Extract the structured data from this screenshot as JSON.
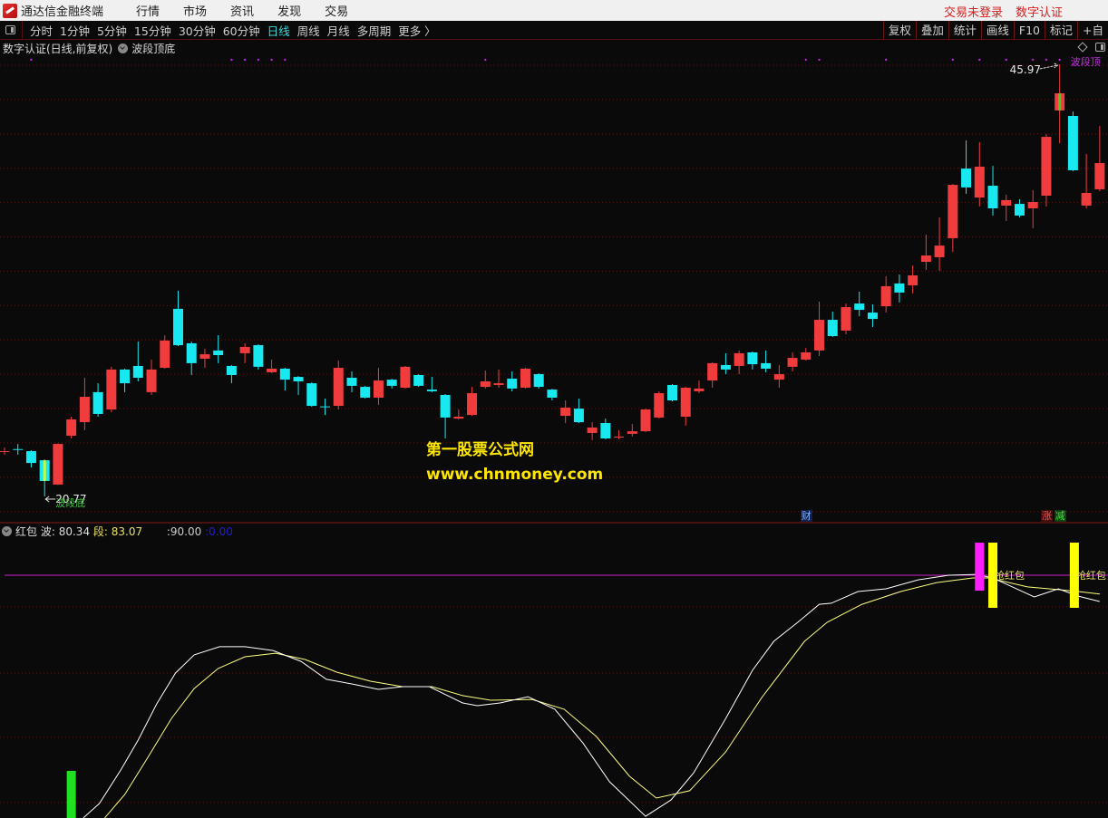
{
  "titlebar": {
    "app_name": "通达信金融终端",
    "menus": [
      "行情",
      "市场",
      "资讯",
      "发现",
      "交易"
    ],
    "right": [
      "交易未登录",
      "数字认证"
    ]
  },
  "toolbar": {
    "periods": [
      "分时",
      "1分钟",
      "5分钟",
      "15分钟",
      "30分钟",
      "60分钟",
      "日线",
      "周线",
      "月线",
      "多周期",
      "更多 〉"
    ],
    "active_period": "日线",
    "right_buttons": [
      "复权",
      "叠加",
      "统计",
      "画线",
      "F10",
      "标记",
      "+自"
    ]
  },
  "info": {
    "stock": "数字认证(日线,前复权)",
    "indicator": "波段顶底"
  },
  "annotations": {
    "high_label": "45.97",
    "low_label": "20.77",
    "top_signal": "波段顶",
    "bottom_signal": "波段底",
    "event_cai": "财",
    "event_zhang": "涨",
    "event_jian": "减"
  },
  "watermark": {
    "line1": "第一股票公式网",
    "line2": "www.chnmoney.com"
  },
  "indicator": {
    "name": "红包",
    "wave_label": "波:",
    "wave_value": "80.34",
    "seg_label": "段:",
    "seg_value": "83.07",
    "level_label": ":90.00",
    "zero_label": ":0.00",
    "signal_text": "抢红包"
  },
  "colors": {
    "up": "#f03c3c",
    "down": "#18e8f0",
    "wave": "#ffffff",
    "seg": "#ffff80",
    "level": "#d020d0",
    "grid": "#5c1818",
    "magenta": "#ff20ff",
    "yellow": "#ffff00",
    "green": "#20e020"
  },
  "chart_data": {
    "type": "candlestick",
    "price_range": [
      20.77,
      45.97
    ],
    "candles": [
      [
        23.38,
        23.62,
        23.2,
        23.41
      ],
      [
        23.53,
        23.83,
        23.2,
        23.5
      ],
      [
        23.41,
        23.46,
        22.46,
        22.72
      ],
      [
        22.88,
        22.93,
        20.77,
        21.67
      ],
      [
        21.46,
        23.86,
        21.43,
        23.83
      ],
      [
        24.31,
        25.42,
        24.15,
        25.26
      ],
      [
        25.1,
        27.69,
        24.63,
        26.58
      ],
      [
        26.85,
        27.37,
        25.42,
        25.58
      ],
      [
        25.84,
        28.33,
        25.68,
        28.17
      ],
      [
        28.17,
        28.22,
        26.85,
        27.37
      ],
      [
        28.38,
        29.8,
        27.48,
        27.69
      ],
      [
        26.85,
        28.75,
        26.69,
        28.17
      ],
      [
        28.27,
        30.17,
        28.22,
        29.86
      ],
      [
        31.71,
        32.76,
        29.54,
        29.59
      ],
      [
        29.7,
        29.8,
        27.85,
        28.54
      ],
      [
        28.8,
        29.38,
        28.27,
        29.06
      ],
      [
        29.28,
        30.17,
        28.54,
        29.01
      ],
      [
        28.38,
        28.43,
        27.37,
        27.85
      ],
      [
        29.12,
        29.7,
        28.54,
        29.49
      ],
      [
        29.59,
        29.64,
        28.17,
        28.33
      ],
      [
        28.01,
        28.75,
        27.96,
        28.22
      ],
      [
        28.22,
        28.27,
        26.95,
        27.58
      ],
      [
        27.74,
        27.79,
        26.69,
        27.48
      ],
      [
        27.37,
        27.42,
        26.0,
        26.05
      ],
      [
        26.02,
        26.48,
        25.52,
        25.98
      ],
      [
        26.05,
        28.7,
        25.84,
        28.27
      ],
      [
        27.69,
        28.06,
        26.85,
        27.22
      ],
      [
        27.16,
        27.21,
        26.48,
        26.53
      ],
      [
        26.53,
        28.27,
        26.11,
        27.53
      ],
      [
        27.58,
        27.63,
        27.06,
        27.22
      ],
      [
        27.11,
        28.38,
        27.06,
        28.33
      ],
      [
        27.85,
        27.9,
        27.16,
        27.22
      ],
      [
        27.0,
        27.74,
        26.85,
        26.9
      ],
      [
        26.69,
        26.74,
        24.15,
        25.37
      ],
      [
        25.31,
        25.84,
        25.26,
        25.42
      ],
      [
        25.52,
        27.16,
        25.47,
        26.79
      ],
      [
        27.16,
        28.11,
        27.06,
        27.48
      ],
      [
        27.27,
        28.17,
        27.11,
        27.37
      ],
      [
        27.64,
        28.06,
        26.9,
        27.06
      ],
      [
        27.11,
        28.27,
        27.06,
        28.22
      ],
      [
        27.9,
        27.95,
        27.06,
        27.16
      ],
      [
        27.0,
        27.05,
        26.37,
        26.53
      ],
      [
        25.47,
        26.37,
        25.05,
        25.95
      ],
      [
        25.89,
        26.48,
        25.05,
        25.1
      ],
      [
        24.47,
        25.1,
        24.05,
        24.79
      ],
      [
        25.05,
        25.31,
        24.1,
        24.15
      ],
      [
        24.2,
        24.63,
        24.1,
        24.26
      ],
      [
        24.42,
        24.99,
        24.26,
        24.57
      ],
      [
        24.57,
        25.89,
        24.52,
        25.84
      ],
      [
        25.37,
        26.9,
        25.31,
        26.79
      ],
      [
        27.27,
        27.32,
        26.32,
        26.37
      ],
      [
        25.42,
        27.16,
        24.89,
        27.11
      ],
      [
        26.9,
        27.53,
        26.79,
        27.06
      ],
      [
        27.53,
        28.59,
        27.11,
        28.54
      ],
      [
        28.43,
        29.12,
        27.9,
        28.17
      ],
      [
        28.38,
        29.28,
        27.9,
        29.12
      ],
      [
        29.17,
        29.22,
        28.17,
        28.48
      ],
      [
        28.54,
        29.28,
        28.01,
        28.22
      ],
      [
        27.58,
        28.43,
        27.11,
        27.9
      ],
      [
        28.33,
        29.17,
        28.06,
        28.85
      ],
      [
        28.75,
        29.43,
        28.7,
        29.17
      ],
      [
        29.28,
        32.13,
        28.96,
        31.07
      ],
      [
        31.07,
        31.55,
        30.07,
        30.12
      ],
      [
        30.44,
        32.02,
        30.23,
        31.81
      ],
      [
        32.02,
        32.71,
        31.28,
        31.65
      ],
      [
        31.49,
        31.97,
        30.65,
        31.12
      ],
      [
        31.86,
        33.61,
        31.49,
        33.03
      ],
      [
        33.19,
        33.71,
        32.08,
        32.66
      ],
      [
        33.08,
        34.24,
        32.6,
        33.66
      ],
      [
        34.45,
        36.04,
        33.98,
        34.82
      ],
      [
        34.72,
        37.04,
        33.93,
        35.4
      ],
      [
        35.83,
        38.99,
        35.03,
        38.94
      ],
      [
        39.89,
        41.53,
        38.42,
        38.79
      ],
      [
        38.2,
        41.43,
        37.68,
        40.0
      ],
      [
        38.89,
        40.05,
        37.15,
        37.57
      ],
      [
        37.73,
        38.36,
        36.83,
        38.05
      ],
      [
        37.83,
        38.1,
        37.04,
        37.15
      ],
      [
        37.57,
        38.63,
        36.41,
        37.94
      ],
      [
        38.31,
        41.9,
        37.68,
        41.74
      ],
      [
        43.28,
        45.97,
        41.37,
        44.28
      ],
      [
        42.96,
        43.22,
        39.74,
        39.79
      ],
      [
        37.73,
        40.74,
        37.57,
        38.47
      ],
      [
        38.68,
        42.38,
        38.57,
        40.21
      ]
    ],
    "highlight_candles": [
      {
        "index": 3,
        "color": "#c8ff40"
      },
      {
        "index": 79,
        "color": "#40d020"
      }
    ],
    "top_dots": [
      2,
      17,
      18,
      19,
      20,
      21,
      36,
      60,
      61,
      66,
      71,
      73,
      75,
      77,
      78,
      79
    ],
    "high_index": 79,
    "low_index": 3,
    "cai_index": 60,
    "zhang_index": 78,
    "jian_index": 79,
    "indicator_range": [
      0,
      90
    ],
    "wave": [
      [
        5.9,
        0.7
      ],
      [
        7.1,
        6
      ],
      [
        8.7,
        18.3
      ],
      [
        10,
        29.3
      ],
      [
        11.4,
        42.7
      ],
      [
        12.8,
        54
      ],
      [
        14.2,
        60.7
      ],
      [
        16.1,
        63.7
      ],
      [
        18,
        63.7
      ],
      [
        20.1,
        62.3
      ],
      [
        22.2,
        58.3
      ],
      [
        24.1,
        51.7
      ],
      [
        26,
        50
      ],
      [
        28,
        48
      ],
      [
        29.8,
        49
      ],
      [
        31.8,
        49
      ],
      [
        34.3,
        43
      ],
      [
        35.4,
        42
      ],
      [
        37.1,
        43
      ],
      [
        39.2,
        45.3
      ],
      [
        41.2,
        40.7
      ],
      [
        43.3,
        28.3
      ],
      [
        45.3,
        14
      ],
      [
        48,
        1.3
      ],
      [
        49.9,
        7.3
      ],
      [
        51.6,
        17.3
      ],
      [
        54,
        37.3
      ],
      [
        56,
        55
      ],
      [
        57.6,
        65.7
      ],
      [
        59.4,
        72.7
      ],
      [
        61,
        79.3
      ],
      [
        61.9,
        79.7
      ],
      [
        63.9,
        84
      ],
      [
        66,
        85
      ],
      [
        68.4,
        88.3
      ],
      [
        70.7,
        90
      ],
      [
        72.8,
        90.3
      ],
      [
        73.7,
        89.3
      ],
      [
        74.3,
        88.3
      ],
      [
        77.1,
        82
      ],
      [
        78.9,
        85
      ],
      [
        80.4,
        82.3
      ],
      [
        82,
        80.34
      ]
    ],
    "segment": [
      [
        7.5,
        0.7
      ],
      [
        9,
        9.3
      ],
      [
        10.7,
        22.7
      ],
      [
        12.5,
        37.3
      ],
      [
        14.2,
        48.3
      ],
      [
        16,
        55.7
      ],
      [
        18,
        60
      ],
      [
        20.3,
        61.3
      ],
      [
        22.5,
        59
      ],
      [
        24.9,
        54.3
      ],
      [
        27.4,
        51
      ],
      [
        29.8,
        49
      ],
      [
        32,
        49
      ],
      [
        34.3,
        45.7
      ],
      [
        36.4,
        44
      ],
      [
        39.5,
        44.3
      ],
      [
        41.9,
        40.7
      ],
      [
        44.3,
        30.7
      ],
      [
        46.8,
        16
      ],
      [
        48.8,
        8
      ],
      [
        51.3,
        10.7
      ],
      [
        54,
        25
      ],
      [
        56.7,
        45
      ],
      [
        59.9,
        65.7
      ],
      [
        61.6,
        72.7
      ],
      [
        64.2,
        79.3
      ],
      [
        67.1,
        84
      ],
      [
        69.8,
        87.3
      ],
      [
        72.5,
        89
      ],
      [
        73.7,
        89
      ],
      [
        76.6,
        85.7
      ],
      [
        78.9,
        84.7
      ],
      [
        80.4,
        84
      ],
      [
        82,
        83.07
      ]
    ],
    "level_line": 90,
    "signal_bars": [
      {
        "index": 5,
        "from": 0,
        "to": 18,
        "color": "green"
      },
      {
        "index": 73,
        "from": 84.3,
        "to": 102,
        "color": "magenta"
      },
      {
        "index": 74,
        "from": 78,
        "to": 102,
        "color": "yellow",
        "label": true
      },
      {
        "index": 80.1,
        "from": 78,
        "to": 102,
        "color": "yellow",
        "label": true
      }
    ]
  }
}
